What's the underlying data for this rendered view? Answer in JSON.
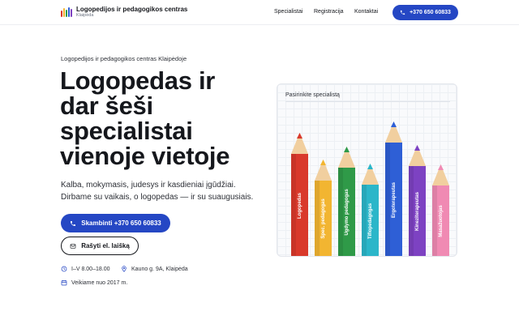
{
  "header": {
    "brand_name": "Logopedijos ir pedagogikos centras",
    "brand_sub": "Klaipėda",
    "nav": [
      "Specialistai",
      "Registracija",
      "Kontaktai"
    ],
    "call_label": "+370 650 60833"
  },
  "hero": {
    "eyebrow": "Logopedijos ir pedagogikos centras Klaipėdoje",
    "title": "Logopedas ir dar šeši specialistai vienoje vietoje",
    "desc_line1": "Kalba, mokymasis, judesys ir kasdieniai įgūdžiai.",
    "desc_line2": "Dirbame su vaikais, o logopedas — ir su suaugusiais.",
    "call_button": "Skambinti +370 650 60833",
    "email_button": "Rašyti el. laišką",
    "hours": "I–V 8.00–18.00",
    "address": "Kauno g. 9A, Klaipėda",
    "since": "Veikiame nuo 2017 m."
  },
  "card": {
    "title": "Pasirinkite specialistą",
    "pencils": [
      {
        "label": "Logopedas",
        "color": "#d9392b",
        "height_frac": 0.89
      },
      {
        "label": "Spec. pedagogas",
        "color": "#f2b531",
        "height_frac": 0.7
      },
      {
        "label": "Ugdymo pedagogas",
        "color": "#2f9a48",
        "height_frac": 0.79
      },
      {
        "label": "Tiflopedagogas",
        "color": "#2bb6c9",
        "height_frac": 0.67
      },
      {
        "label": "Ergoterapeutas",
        "color": "#2e5fd6",
        "height_frac": 0.97
      },
      {
        "label": "Kineziterapeutas",
        "color": "#7d42c2",
        "height_frac": 0.8
      },
      {
        "label": "Masažuotojas",
        "color": "#f08ab3",
        "height_frac": 0.66
      }
    ]
  },
  "colors": {
    "accent": "#2547c4",
    "text": "#15171c"
  },
  "icons": [
    "logo-bars",
    "phone-icon",
    "mail-icon",
    "clock-icon",
    "location-pin-icon",
    "calendar-icon"
  ]
}
